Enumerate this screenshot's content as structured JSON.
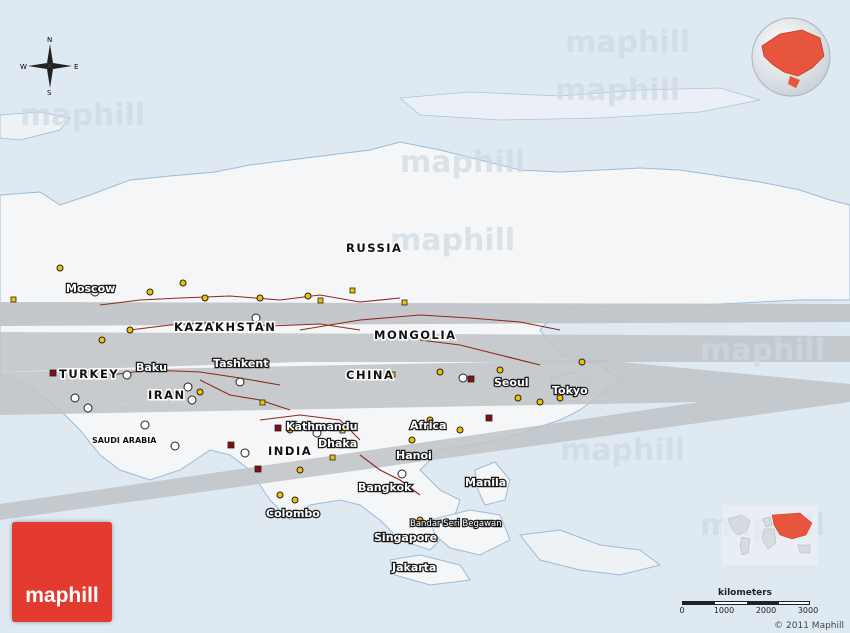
{
  "watermark": "maphill",
  "brand": {
    "logo_text": "maphill",
    "color": "#e23a2e"
  },
  "copyright": "© 2011 Maphill",
  "compass": {
    "n": "N",
    "s": "S",
    "e": "E",
    "w": "W"
  },
  "scale": {
    "unit": "kilometers",
    "ticks": [
      "0",
      "1000",
      "2000",
      "3000"
    ]
  },
  "countries": {
    "russia": "RUSSIA",
    "kazakhstan": "KAZAKHSTAN",
    "mongolia": "MONGOLIA",
    "china": "CHINA",
    "turkey": "TURKEY",
    "iran": "IRAN",
    "saudi_arabia": "SAUDI ARABIA",
    "india": "INDIA"
  },
  "cities": {
    "moscow": "Moscow",
    "baku": "Baku",
    "tashkent": "Tashkent",
    "seoul": "Seoul",
    "tokyo": "Tokyo",
    "kathmandu": "Kathmandu",
    "dhaka": "Dhaka",
    "africa": "Africa",
    "hanoi": "Hanoi",
    "bangkok": "Bangkok",
    "manila": "Manila",
    "colombo": "Colombo",
    "bandar_seri_begawan": "Bandar Seri Begawan",
    "singapore": "Singapore",
    "jakarta": "Jakarta"
  },
  "colors": {
    "sea": "#dfe9f2",
    "land": "#f4f6f8",
    "band": "#bfc3c7",
    "border": "#8a2a1a",
    "highlight": "#e8553f"
  }
}
